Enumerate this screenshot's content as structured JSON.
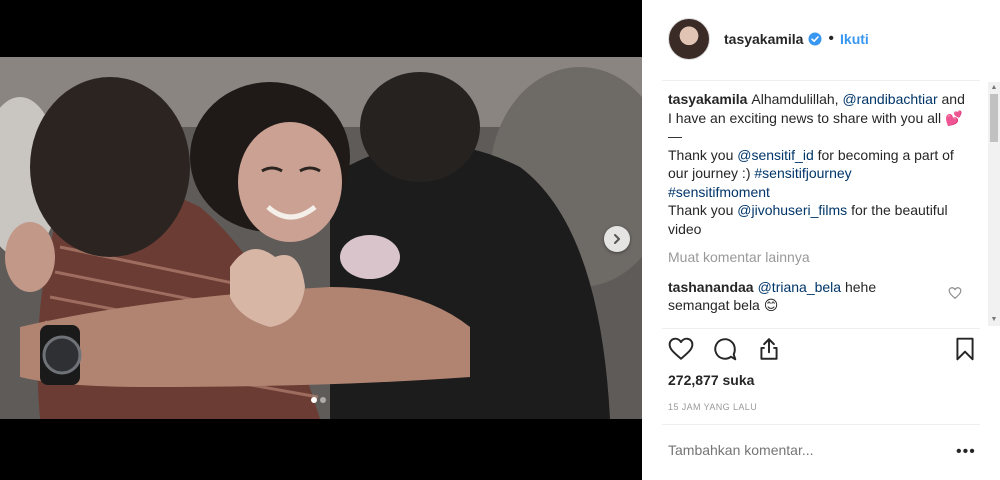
{
  "post": {
    "username": "tasyakamila",
    "follow_label": "Ikuti",
    "bullet": "•",
    "caption": {
      "user": "tasyakamila",
      "line1_pre": "Alhamdulillah, ",
      "mention1": "@randibachtiar",
      "line1_post": " and I have an exciting news to share with you all ",
      "emoji": "💕",
      "dash": "—",
      "thanks1_pre": "Thank you ",
      "mention2": "@sensitif_id",
      "thanks1_post": " for becoming a part of our journey :) ",
      "hashtag1": "#sensitifjourney",
      "hashtag2": "#sensitifmoment",
      "thanks2_pre": "Thank you ",
      "mention3": "@jivohuseri_films",
      "thanks2_post": " for the beautiful video"
    },
    "load_more_label": "Muat komentar lainnya",
    "comment": {
      "user": "tashanandaa",
      "mention": "@triana_bela",
      "text": " hehe",
      "overflow_text": "semangat bela 😊"
    },
    "likes_label": "272,877 suka",
    "time_label": "15 JAM YANG LALU",
    "add_comment_placeholder": "Tambahkan komentar...",
    "more_label": "•••"
  },
  "carousel": {
    "total": 2,
    "active": 1
  },
  "icons": {
    "verified": "verified-badge-icon",
    "next": "chevron-right-icon",
    "like": "heart-icon",
    "comment": "comment-icon",
    "share": "share-icon",
    "save": "bookmark-icon",
    "comment_like": "small-heart-icon"
  },
  "colors": {
    "link": "#003569",
    "follow": "#3897f0",
    "muted": "#999999",
    "verified": "#3897f0"
  }
}
